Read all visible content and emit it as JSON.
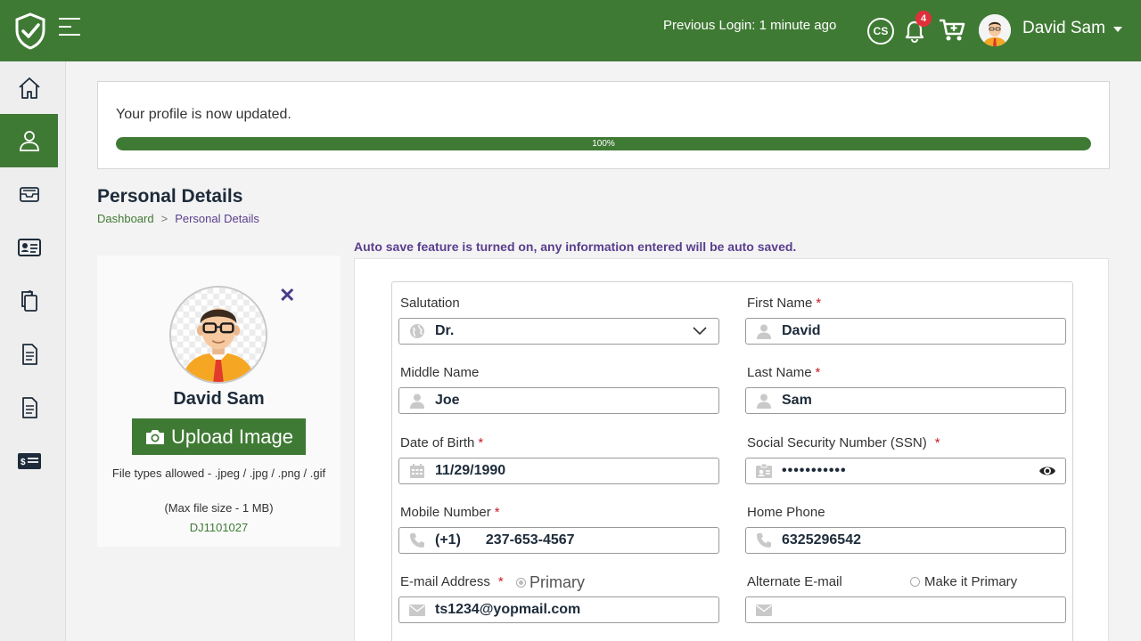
{
  "header": {
    "previous_login": "Previous Login: 1 minute ago",
    "cs_label": "CS",
    "notification_count": "4",
    "user_name": "David Sam"
  },
  "notice": {
    "message": "Your profile is now updated.",
    "progress_label": "100%",
    "progress_value": 100
  },
  "page": {
    "title": "Personal Details",
    "breadcrumb": [
      "Dashboard",
      ">",
      "Personal Details"
    ],
    "autosave": "Auto save feature is turned on, any information entered will be auto saved."
  },
  "profile": {
    "name": "David Sam",
    "upload_label": "Upload Image",
    "file_types": "File types allowed - .jpeg / .jpg / .png / .gif",
    "max_size": "(Max file size - 1 MB)",
    "id": "DJ1101027"
  },
  "form": {
    "salutation": {
      "label": "Salutation",
      "value": "Dr."
    },
    "first_name": {
      "label": "First Name",
      "value": "David",
      "required": "*"
    },
    "middle_name": {
      "label": "Middle Name",
      "value": "Joe"
    },
    "last_name": {
      "label": "Last Name",
      "value": "Sam",
      "required": "*"
    },
    "dob": {
      "label": "Date of Birth",
      "value": "11/29/1990",
      "required": "*"
    },
    "ssn": {
      "label": "Social Security Number (SSN)",
      "value": "•••••••••••",
      "required": "*"
    },
    "mobile": {
      "label": "Mobile Number",
      "code": "(+1)",
      "value": "237-653-4567",
      "required": "*"
    },
    "home_phone": {
      "label": "Home Phone",
      "value": "6325296542"
    },
    "email": {
      "label": "E-mail Address",
      "value": "ts1234@yopmail.com",
      "required": "*",
      "primary_label": "Primary"
    },
    "alt_email": {
      "label": "Alternate E-mail",
      "value": "",
      "make_primary_label": "Make it Primary"
    }
  },
  "colors": {
    "brand_green": "#3f7a34",
    "accent_purple": "#5a3e8d",
    "required_red": "#c81d25"
  },
  "icons": {
    "sidebar": [
      "home-icon",
      "user-icon",
      "inbox-icon",
      "id-card-icon",
      "documents-icon",
      "file-icon",
      "file-text-icon",
      "payment-card-icon"
    ]
  }
}
